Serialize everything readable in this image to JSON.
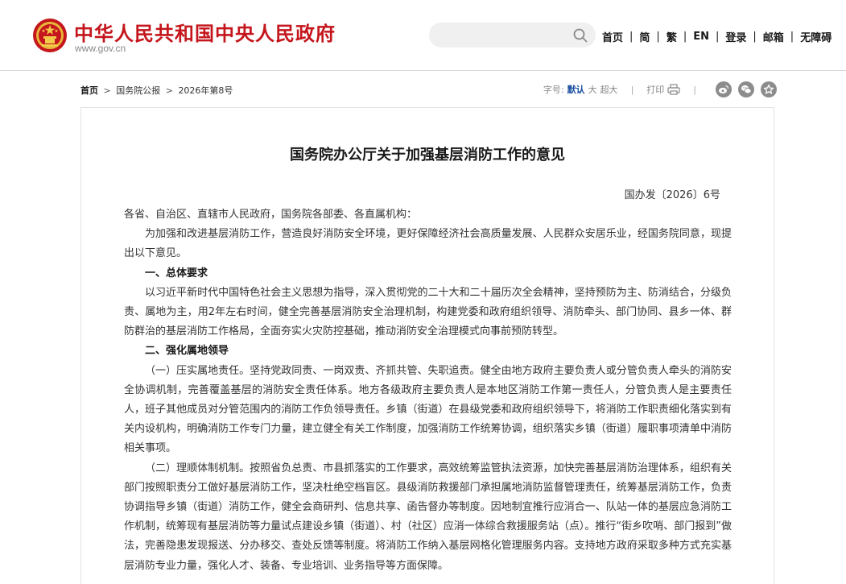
{
  "header": {
    "site_title": "中华人民共和国中央人民政府",
    "site_domain": "www.gov.cn",
    "search_placeholder": "",
    "nav": [
      "首页",
      "简",
      "繁",
      "EN",
      "登录",
      "邮箱",
      "无障碍"
    ],
    "nav_separator": "|"
  },
  "breadcrumb": {
    "home": "首页",
    "separator": ">",
    "items": [
      "国务院公报",
      "2026年第8号"
    ]
  },
  "tools": {
    "font_size_label": "字号:",
    "font_size_options": [
      "默认",
      "大",
      "超大"
    ],
    "active_font_size": "默认",
    "separator": "|",
    "print_label": "打印",
    "share_icons": [
      "weibo-icon",
      "wechat-icon",
      "favorite-icon"
    ]
  },
  "document": {
    "title": "国务院办公厅关于加强基层消防工作的意见",
    "number": "国办发〔2026〕6号",
    "salutation": "各省、自治区、直辖市人民政府，国务院各部委、各直属机构：",
    "intro": "为加强和改进基层消防工作，营造良好消防安全环境，更好保障经济社会高质量发展、人民群众安居乐业，经国务院同意，现提出以下意见。",
    "section1_heading": "一、总体要求",
    "section1_text": "以习近平新时代中国特色社会主义思想为指导，深入贯彻党的二十大和二十届历次全会精神，坚持预防为主、防消结合，分级负责、属地为主，用2年左右时间，健全完善基层消防安全治理机制，构建党委和政府组织领导、消防牵头、部门协同、县乡一体、群防群治的基层消防工作格局，全面夯实火灾防控基础，推动消防安全治理模式向事前预防转型。",
    "section2_heading": "二、强化属地领导",
    "section2_para1": "（一）压实属地责任。坚持党政同责、一岗双责、齐抓共管、失职追责。健全由地方政府主要负责人或分管负责人牵头的消防安全协调机制，完善覆盖基层的消防安全责任体系。地方各级政府主要负责人是本地区消防工作第一责任人，分管负责人是主要责任人，班子其他成员对分管范围内的消防工作负领导责任。乡镇（街道）在县级党委和政府组织领导下，将消防工作职责细化落实到有关内设机构，明确消防工作专门力量，建立健全有关工作制度，加强消防工作统筹协调，组织落实乡镇（街道）履职事项清单中消防相关事项。",
    "section2_para2": "（二）理顺体制机制。按照省负总责、市县抓落实的工作要求，高效统筹监管执法资源，加快完善基层消防治理体系，组织有关部门按照职责分工做好基层消防工作，坚决杜绝空档盲区。县级消防救援部门承担属地消防监督管理责任，统筹基层消防工作，负责协调指导乡镇（街道）消防工作，健全会商研判、信息共享、函告督办等制度。因地制宜推行应消合一、队站一体的基层应急消防工作机制，统筹现有基层消防等力量试点建设乡镇（街道）、村（社区）应消一体综合救援服务站（点）。推行“街乡吹哨、部门报到”做法，完善隐患发现报送、分办移交、查处反馈等制度。将消防工作纳入基层网格化管理服务内容。支持地方政府采取多种方式充实基层消防专业力量，强化人才、装备、专业培训、业务指导等方面保障。"
  },
  "colors": {
    "brand_red": "#c4161c",
    "accent_blue": "#1a4fa0",
    "icon_gray": "#8c8c8c"
  }
}
